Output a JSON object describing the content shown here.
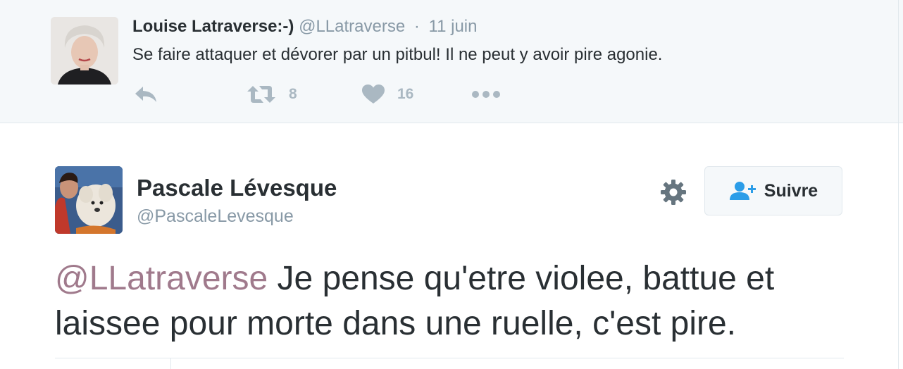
{
  "parent_tweet": {
    "author_name": "Louise Latraverse:-)",
    "author_handle": "@LLatraverse",
    "separator": "·",
    "date": "11 juin",
    "text": "Se faire attaquer et dévorer par un pitbul! Il ne peut y avoir pire agonie.",
    "actions": {
      "reply_icon": "reply-icon",
      "retweet_icon": "retweet-icon",
      "retweet_count": "8",
      "like_icon": "heart-icon",
      "like_count": "16",
      "more_icon": "more-dots-icon"
    }
  },
  "main_tweet": {
    "author_name": "Pascale Lévesque",
    "author_handle": "@PascaleLevesque",
    "settings_icon": "gear-icon",
    "follow_icon": "add-user-icon",
    "follow_label": "Suivre",
    "mention": "@LLatraverse",
    "text_body": " Je pense qu'etre violee, battue et laissee pour morte dans une ruelle, c'est pire."
  },
  "colors": {
    "icon_gray": "#aab8c2",
    "meta_gray": "#8899a6",
    "mention": "#a07a8c",
    "follow_icon_blue": "#2b9de8",
    "background_parent": "#f5f8fa"
  }
}
